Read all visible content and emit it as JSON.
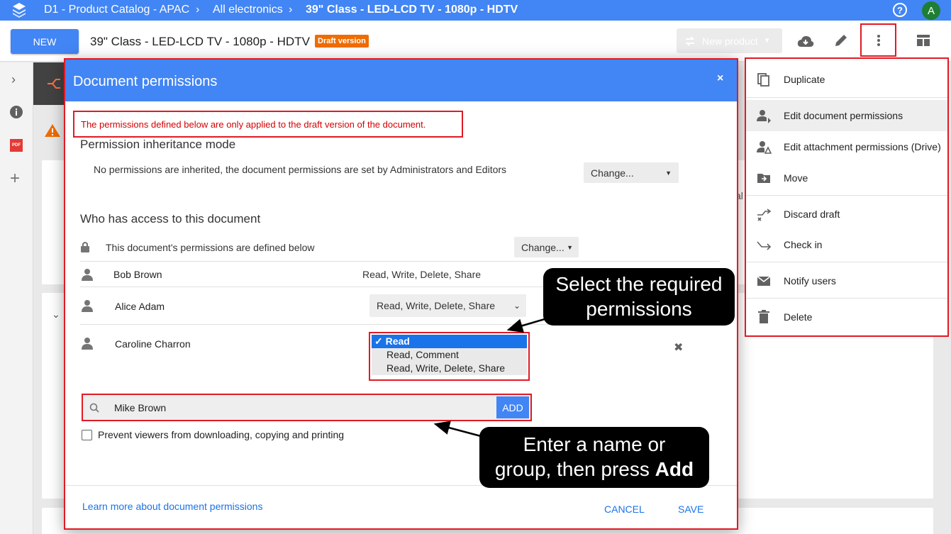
{
  "topbar": {
    "crumb1": "D1 - Product Catalog - APAC",
    "crumb2": "All electronics",
    "crumb3": "39\" Class - LED-LCD TV - 1080p - HDTV",
    "avatar": "A",
    "icons": [
      "apps-logo-icon",
      "chevron-right-icon",
      "help-icon",
      "avatar"
    ]
  },
  "header": {
    "new_label": "NEW",
    "title": "39\" Class - LED-LCD TV - 1080p - HDTV",
    "badge": "Draft version",
    "new_product_label": "New product",
    "icons": [
      "download-icon",
      "edit-icon",
      "more-vert-icon",
      "layout-icon"
    ]
  },
  "background": {
    "partial_text": "al"
  },
  "modal": {
    "title": "Document permissions",
    "close": "×",
    "warning": "The permissions defined below are only applied to the draft version of the document.",
    "inheritance_heading": "Permission inheritance mode",
    "inheritance_text": "No permissions are inherited, the document permissions are set by Administrators and Editors",
    "inheritance_select": "Change...",
    "access_heading": "Who has access to this document",
    "defined_text": "This document's permissions are defined below",
    "defined_select": "Change...",
    "users": [
      {
        "name": "Bob Brown",
        "permission": "Read, Write, Delete, Share"
      },
      {
        "name": "Alice Adam",
        "permission": "Read, Write, Delete, Share"
      },
      {
        "name": "Caroline Charron",
        "permission": "Read"
      }
    ],
    "dropdown_options": [
      "Read",
      "Read, Comment",
      "Read, Write, Delete, Share"
    ],
    "dropdown_selected": "Read",
    "remove": "✖",
    "search_value": "Mike Brown",
    "add_label": "ADD",
    "checkbox_label": "Prevent viewers from downloading, copying and printing",
    "learn_more": "Learn more about document permissions",
    "cancel": "CANCEL",
    "save": "SAVE"
  },
  "menu": {
    "items": [
      {
        "label": "Duplicate",
        "icon": "duplicate-icon"
      },
      {
        "label": "Edit document permissions",
        "icon": "user-permissions-icon"
      },
      {
        "label": "Edit attachment permissions (Drive)",
        "icon": "attachment-permissions-icon"
      },
      {
        "label": "Move",
        "icon": "move-folder-icon"
      },
      {
        "label": "Discard draft",
        "icon": "discard-draft-icon"
      },
      {
        "label": "Check in",
        "icon": "check-in-icon"
      },
      {
        "label": "Notify users",
        "icon": "mail-icon"
      },
      {
        "label": "Delete",
        "icon": "trash-icon"
      }
    ]
  },
  "callouts": {
    "select_perm_line1": "Select the required",
    "select_perm_line2": "permissions",
    "enter_name_line1": "Enter a name or",
    "enter_name_line2": "group, then press ",
    "enter_name_bold": "Add"
  },
  "colors": {
    "primary": "#4285f4",
    "highlight": "#e01b24",
    "badge": "#ef6c00",
    "selected_option": "#1a73e8"
  }
}
